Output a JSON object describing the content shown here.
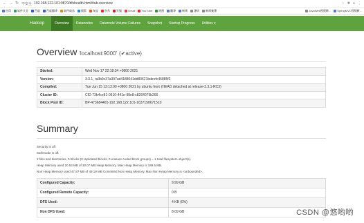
{
  "browser": {
    "security": "不安全",
    "url": "192.168.122.101:9870/dfshealth.html#tab-overview"
  },
  "bookmarks": [
    {
      "label": "应用",
      "color": "#4a7bd0"
    },
    {
      "label": "软件大全",
      "color": "#3a9d5d"
    },
    {
      "label": "百度",
      "color": "#2c5dd6"
    },
    {
      "label": "百度翻译",
      "color": "#2c5dd6"
    },
    {
      "label": "软件商务",
      "color": "#e08a1e"
    },
    {
      "label": "搜索",
      "color": "#1f8ad4"
    },
    {
      "label": "淘宝",
      "color": "#f05a1a"
    },
    {
      "label": "京东",
      "color": "#d32"
    },
    {
      "label": "天猫",
      "color": "#d22"
    },
    {
      "label": "Gmail",
      "color": "#d44"
    },
    {
      "label": "YouTube",
      "color": "#e22"
    },
    {
      "label": "地图",
      "color": "#3b8f3b"
    },
    {
      "label": "翻译",
      "color": "#4a7bd0"
    },
    {
      "label": "新闻",
      "color": "#4a7bd0"
    },
    {
      "label": "源码",
      "color": "#888"
    },
    {
      "label": "新闻集锦",
      "color": "#888"
    }
  ],
  "bookmarks_right": [
    {
      "label": "JavaWeb视频教...",
      "color": "#888"
    },
    {
      "label": "SpringMVC视频教...",
      "color": "#4a7bd0"
    }
  ],
  "navbar": {
    "brand": "Hadoop",
    "items": [
      "Overview",
      "Datanodes",
      "Datanode Volume Failures",
      "Snapshot",
      "Startup Progress",
      "Utilities ▾"
    ]
  },
  "overview": {
    "title": "Overview",
    "host": "'localhost:9000'",
    "status": "(✔active)",
    "rows": [
      {
        "key": "Started:",
        "value": "Wed Nov 17 22:18:34 +0800 2021"
      },
      {
        "key": "Version:",
        "value": "3.3.1, ra3b9c37a397ad4188041dd80621bdeefc46885f2"
      },
      {
        "key": "Compiled:",
        "value": "Tue Jun 15 13:13:00 +0800 2021 by ubuntu from (HEAD detached at release-3.3.1-RC3)"
      },
      {
        "key": "Cluster ID:",
        "value": "CID-73b4ce81-0510-441e-98e8-c8264075b266"
      },
      {
        "key": "Block Pool ID:",
        "value": "BP-473684465-192.168.122.101-1637158671510"
      }
    ]
  },
  "summary": {
    "title": "Summary",
    "lines": [
      "Security is off.",
      "Safemode is off.",
      "1 files and directories, 0 blocks (0 replicated blocks, 0 erasure coded block groups) = 1 total filesystem object(s).",
      "Heap Memory used 20.53 MB of 30.07 MB Heap Memory. Max Heap Memory is 189.5 MB.",
      "Non Heap Memory used 47.87 MB of 49.19 MB Commited Non Heap Memory. Max Non Heap Memory is <unbounded>."
    ],
    "rows": [
      {
        "key": "Configured Capacity:",
        "value": "9.99 GB"
      },
      {
        "key": "Configured Remote Capacity:",
        "value": "0 B"
      },
      {
        "key": "DFS Used:",
        "value": "4 KB (0%)"
      },
      {
        "key": "Non DFS Used:",
        "value": "8.09 GB"
      }
    ]
  },
  "watermark": "CSDN @悠哟哟"
}
